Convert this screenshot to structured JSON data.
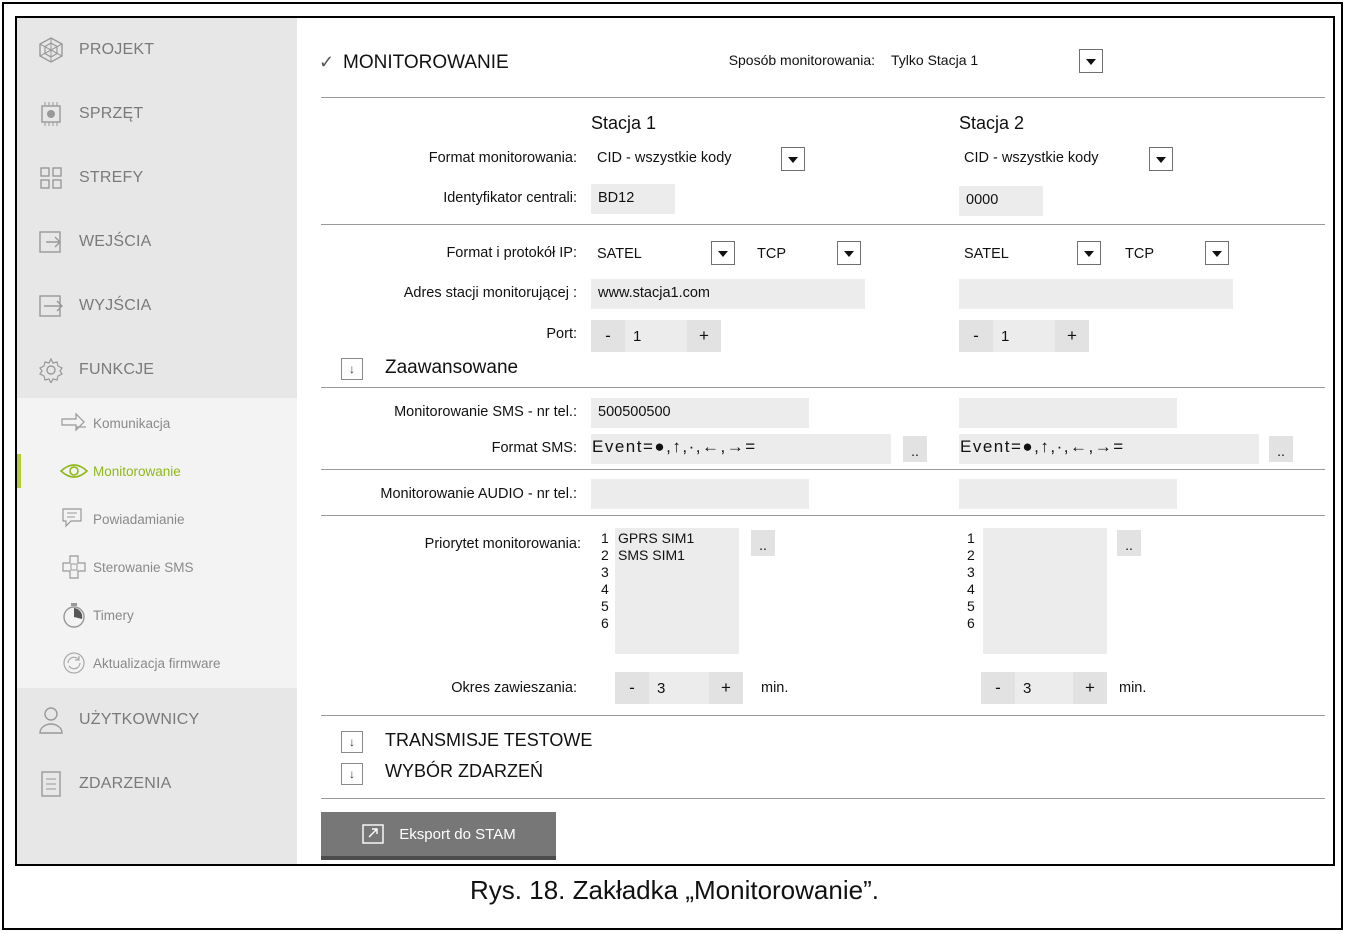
{
  "sidebar": {
    "items": [
      {
        "label": "PROJEKT",
        "icon": "project-icon"
      },
      {
        "label": "SPRZĘT",
        "icon": "hardware-icon"
      },
      {
        "label": "STREFY",
        "icon": "zones-icon"
      },
      {
        "label": "WEJŚCIA",
        "icon": "inputs-icon"
      },
      {
        "label": "WYJŚCIA",
        "icon": "outputs-icon"
      },
      {
        "label": "FUNKCJE",
        "icon": "gear-icon"
      }
    ],
    "sub_items": [
      {
        "label": "Komunikacja",
        "icon": "communication-icon"
      },
      {
        "label": "Monitorowanie",
        "icon": "eye-icon",
        "active": true
      },
      {
        "label": "Powiadamianie",
        "icon": "notification-icon"
      },
      {
        "label": "Sterowanie SMS",
        "icon": "sms-control-icon"
      },
      {
        "label": "Timery",
        "icon": "timer-icon"
      },
      {
        "label": "Aktualizacja firmware",
        "icon": "firmware-update-icon"
      }
    ],
    "bottom_items": [
      {
        "label": "UŻYTKOWNICY",
        "icon": "user-icon"
      },
      {
        "label": "ZDARZENIA",
        "icon": "events-icon"
      }
    ],
    "accent_color": "#8fb81a"
  },
  "main": {
    "monitoring_checked": true,
    "monitoring_title": "MONITOROWANIE",
    "mode_label": "Sposób monitorowania:",
    "mode_value": "Tylko Stacja 1",
    "station1_header": "Stacja 1",
    "station2_header": "Stacja 2",
    "labels": {
      "format": "Format monitorowania:",
      "identifier": "Identyfikator centrali:",
      "ip_format": "Format i protokół IP:",
      "address": "Adres stacji monitorującej :",
      "port": "Port:",
      "advanced": "Zaawansowane",
      "sms_phone": "Monitorowanie SMS - nr tel.:",
      "sms_format": "Format SMS:",
      "audio_phone": "Monitorowanie AUDIO - nr tel.:",
      "priority": "Priorytet monitorowania:",
      "suspend": "Okres zawieszania:",
      "minutes": "min."
    },
    "station1": {
      "format": "CID - wszystkie kody",
      "identifier": "BD12",
      "ip_format": "SATEL",
      "protocol": "TCP",
      "address": "www.stacja1.com",
      "port": "1",
      "sms_phone": "500500500",
      "sms_format": "Event=●,↑,·,←,→=",
      "audio_phone": "",
      "priority_numbers": "1\n2\n3\n4\n5\n6",
      "priority_entries": "GPRS SIM1\nSMS SIM1",
      "suspend": "3"
    },
    "station2": {
      "format": "CID - wszystkie kody",
      "identifier": "0000",
      "ip_format": "SATEL",
      "protocol": "TCP",
      "address": "",
      "port": "1",
      "sms_phone": "",
      "sms_format": "Event=●,↑,·,←,→=",
      "audio_phone": "",
      "priority_numbers": "1\n2\n3\n4\n5\n6",
      "priority_entries": "",
      "suspend": "3"
    },
    "step_minus": "-",
    "step_plus": "+",
    "dots_label": "..",
    "test_transmissions": "TRANSMISJE TESTOWE",
    "event_selection": "WYBÓR ZDARZEŃ",
    "export_label": "Eksport do STAM"
  },
  "caption": "Rys. 18. Zakładka „Monitorowanie”."
}
